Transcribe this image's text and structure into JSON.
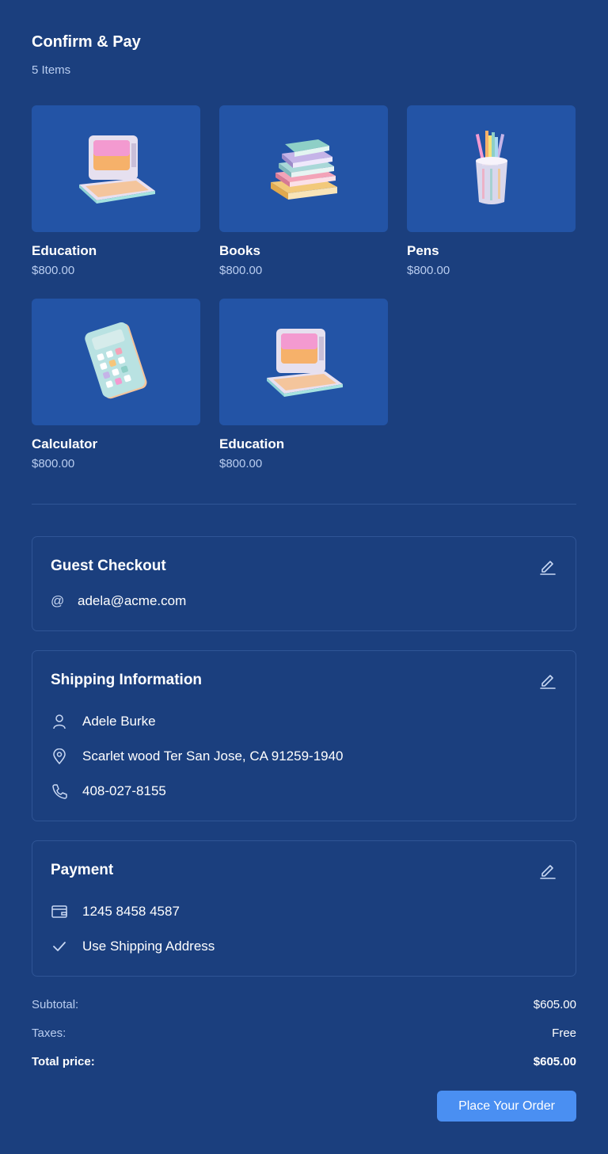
{
  "header": {
    "title": "Confirm & Pay",
    "item_count": "5 Items"
  },
  "products": [
    {
      "name": "Education",
      "price": "$800.00",
      "icon": "retro-computer"
    },
    {
      "name": "Books",
      "price": "$800.00",
      "icon": "book-stack"
    },
    {
      "name": "Pens",
      "price": "$800.00",
      "icon": "pencil-cup"
    },
    {
      "name": "Calculator",
      "price": "$800.00",
      "icon": "calculator"
    },
    {
      "name": "Education",
      "price": "$800.00",
      "icon": "retro-computer"
    }
  ],
  "guest": {
    "title": "Guest Checkout",
    "email_prefix": "@",
    "email": "adela@acme.com"
  },
  "shipping": {
    "title": "Shipping Information",
    "name": "Adele Burke",
    "address": "Scarlet wood Ter San Jose, CA 91259-1940",
    "phone": "408-027-8155"
  },
  "payment": {
    "title": "Payment",
    "card": "1245 8458 4587",
    "billing": "Use Shipping Address"
  },
  "summary": {
    "subtotal_label": "Subtotal:",
    "subtotal": "$605.00",
    "taxes_label": "Taxes:",
    "taxes": "Free",
    "total_label": "Total price:",
    "total": "$605.00"
  },
  "actions": {
    "place_order": "Place Your Order"
  },
  "colors": {
    "background": "#1b3f7e",
    "card": "#2354a6",
    "accent": "#4a8ff2",
    "border": "#2f5596"
  }
}
